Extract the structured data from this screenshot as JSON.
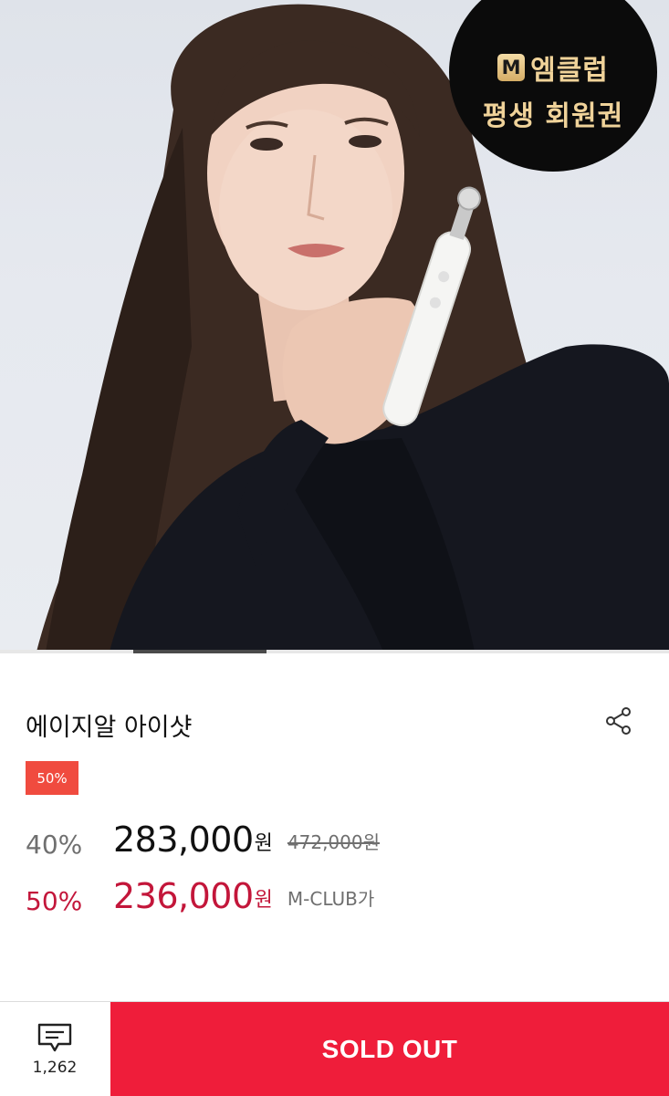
{
  "hero": {
    "badge": {
      "logo_letter": "M",
      "line1": "엠클럽",
      "line2": "평생 회원권"
    },
    "slide_progress": 0.2
  },
  "product": {
    "title": "에이지알 아이샷",
    "discount_badge": "50%",
    "price_rows": [
      {
        "percent": "40%",
        "price": "283,000",
        "currency": "원",
        "original_price": "472,000원"
      },
      {
        "percent": "50%",
        "price": "236,000",
        "currency": "원",
        "note": "M-CLUB가"
      }
    ]
  },
  "bottom_bar": {
    "review_count": "1,262",
    "cta_label": "SOLD OUT"
  },
  "colors": {
    "accent_red": "#ef1d3a",
    "price_red": "#c3163a",
    "badge_red": "#f04b3f",
    "badge_gold": "#f0d39a"
  },
  "icons": [
    "share-icon",
    "review-icon"
  ]
}
